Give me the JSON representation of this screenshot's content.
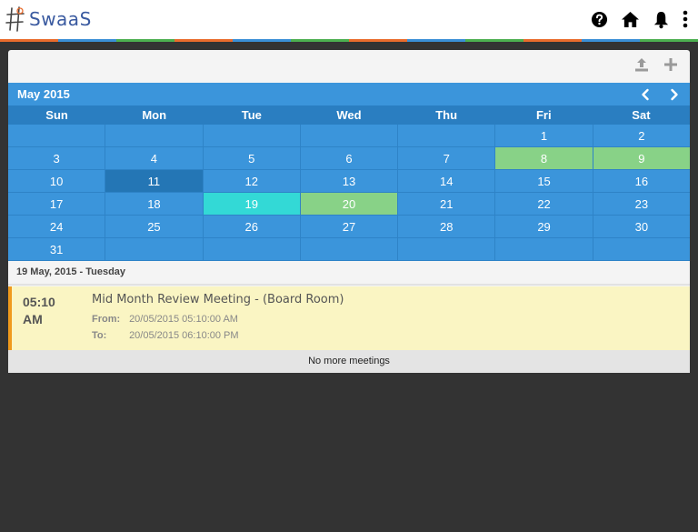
{
  "app": {
    "logo_text": "SwaaS"
  },
  "header": {
    "icons": [
      "help-icon",
      "home-icon",
      "bell-icon",
      "more-vertical-icon"
    ],
    "stripe_colors": [
      "#e96b2c",
      "#3a8fd6",
      "#4caf50",
      "#e96b2c",
      "#3a8fd6",
      "#4caf50",
      "#e96b2c",
      "#3a8fd6",
      "#4caf50",
      "#e96b2c",
      "#3a8fd6",
      "#4caf50"
    ]
  },
  "card": {
    "tools": [
      "upload-icon",
      "add-icon"
    ]
  },
  "calendar": {
    "month_title": "May 2015",
    "days_of_week": [
      "Sun",
      "Mon",
      "Tue",
      "Wed",
      "Thu",
      "Fri",
      "Sat"
    ],
    "weeks": [
      [
        "",
        "",
        "",
        "",
        "",
        "1",
        "2"
      ],
      [
        "3",
        "4",
        "5",
        "6",
        "7",
        "8",
        "9"
      ],
      [
        "10",
        "11",
        "12",
        "13",
        "14",
        "15",
        "16"
      ],
      [
        "17",
        "18",
        "19",
        "20",
        "21",
        "22",
        "23"
      ],
      [
        "24",
        "25",
        "26",
        "27",
        "28",
        "29",
        "30"
      ],
      [
        "31",
        "",
        "",
        "",
        "",
        "",
        ""
      ]
    ],
    "today_day": "11",
    "selected_day": "19",
    "event_days": [
      "8",
      "9",
      "20"
    ],
    "colors": {
      "cell": "#3b95db",
      "today": "#2476b5",
      "event": "#88d287",
      "selected": "#33d9d6"
    }
  },
  "agenda": {
    "date_label": "19 May, 2015 - Tuesday",
    "meetings": [
      {
        "time": "05:10",
        "ampm": "AM",
        "title": "Mid Month Review Meeting - (Board Room)",
        "from_label": "From:",
        "from_value": "20/05/2015 05:10:00 AM",
        "to_label": "To:",
        "to_value": "20/05/2015 06:10:00 PM"
      }
    ],
    "no_more_text": "No more meetings"
  }
}
